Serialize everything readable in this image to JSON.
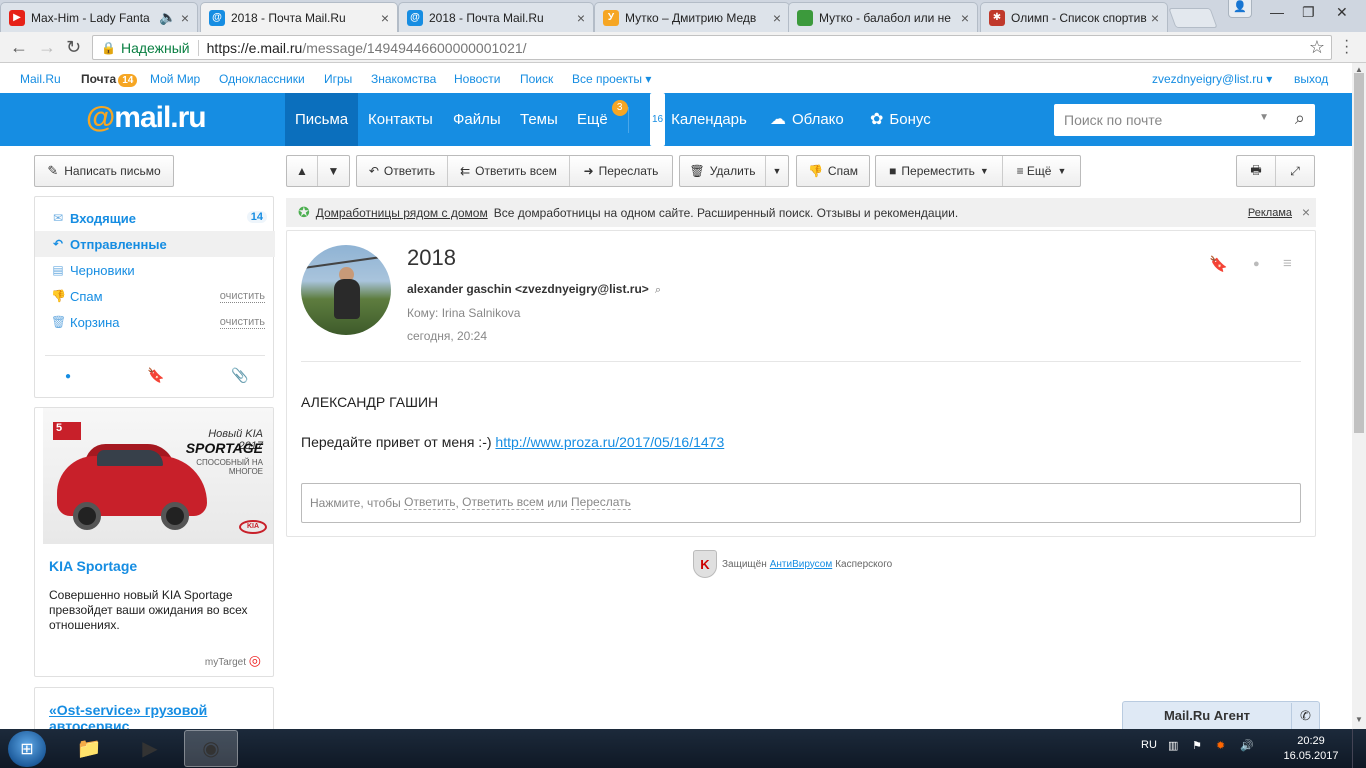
{
  "browser": {
    "tabs": [
      {
        "title": "Max-Him - Lady Fanta",
        "favicon_color": "#e62117",
        "favicon_glyph": "▶",
        "audio": true
      },
      {
        "title": "2018 - Почта Mail.Ru",
        "favicon_color": "#168de2",
        "favicon_glyph": "@",
        "active": true
      },
      {
        "title": "2018 - Почта Mail.Ru",
        "favicon_color": "#168de2",
        "favicon_glyph": "@"
      },
      {
        "title": "Мутко – Дмитрию Медв",
        "favicon_color": "#f6a623",
        "favicon_glyph": "У"
      },
      {
        "title": "Мутко - балабол или не",
        "favicon_color": "#3c9a3c",
        "favicon_glyph": ""
      },
      {
        "title": "Олимп - Список спортив",
        "favicon_color": "#c0392b",
        "favicon_glyph": "✱"
      }
    ],
    "address": {
      "secure_label": "Надежный",
      "host": "https://e.mail.ru",
      "path": "/message/14949446600000001021/"
    }
  },
  "portal": {
    "links": [
      "Mail.Ru",
      "Почта",
      "Мой Мир",
      "Одноклассники",
      "Игры",
      "Знакомства",
      "Новости",
      "Поиск",
      "Все проекты ▾"
    ],
    "mail_badge": "14",
    "user": "zvezdnyeigry@list.ru ▾",
    "logout": "выход"
  },
  "header": {
    "logo_at": "@",
    "logo_text": "mail.ru",
    "nav": [
      "Письма",
      "Контакты",
      "Файлы",
      "Темы",
      "Ещё"
    ],
    "more_badge": "3",
    "services": [
      "Календарь",
      "Облако",
      "Бонус"
    ],
    "calendar_day": "16",
    "search_placeholder": "Поиск по почте",
    "brand_color": "#168de2",
    "accent_color": "#f6a623"
  },
  "sidebar": {
    "compose": "Написать письмо",
    "folders": [
      {
        "label": "Входящие",
        "count": "14"
      },
      {
        "label": "Отправленные"
      },
      {
        "label": "Черновики"
      },
      {
        "label": "Спам",
        "action": "очистить"
      },
      {
        "label": "Корзина",
        "action": "очистить"
      }
    ]
  },
  "toolbar": {
    "reply": "Ответить",
    "reply_all": "Ответить всем",
    "forward": "Переслать",
    "delete": "Удалить",
    "spam": "Спам",
    "move": "Переместить",
    "more": "≡ Ещё"
  },
  "ad_strip": {
    "link": "Домработницы рядом с домом",
    "text": "Все домработницы на одном сайте. Расширенный поиск. Отзывы и рекомендации.",
    "label": "Реклама"
  },
  "message": {
    "subject": "2018",
    "from": "alexander gaschin <zvezdnyeigry@list.ru>",
    "to": "Кому: Irina Salnikova",
    "date": "сегодня, 20:24",
    "body_line1": "АЛЕКСАНДР ГАШИН",
    "body_line2_text": "Передайте привет от меня :-) ",
    "body_link": "http://www.proza.ru/2017/05/16/1473",
    "reply_prompt": "Нажмите, чтобы",
    "reply_actions": [
      "Ответить",
      "Ответить всем",
      "Переслать"
    ],
    "reply_sep1": ",",
    "reply_sep2": "или"
  },
  "kaspersky": {
    "prefix": "Защищён",
    "link": "АнтиВирусом",
    "suffix": "Касперского"
  },
  "ad_kia": {
    "badge": "5",
    "brand_line": "Новый KIA 2017",
    "model": "SPORTAGE",
    "tagline": "СПОСОБНЫЙ НА МНОГОЕ",
    "logo": "KIA",
    "title": "KIA Sportage",
    "text": "Совершенно новый KIA Sportage превзойдет ваши ожидания во всех отношениях.",
    "source": "myTarget"
  },
  "ad_ost": {
    "title": "«Ost-service» грузовой автосервис"
  },
  "agent": {
    "label": "Mail.Ru Агент"
  },
  "taskbar": {
    "lang": "RU",
    "time": "20:29",
    "date": "16.05.2017"
  }
}
